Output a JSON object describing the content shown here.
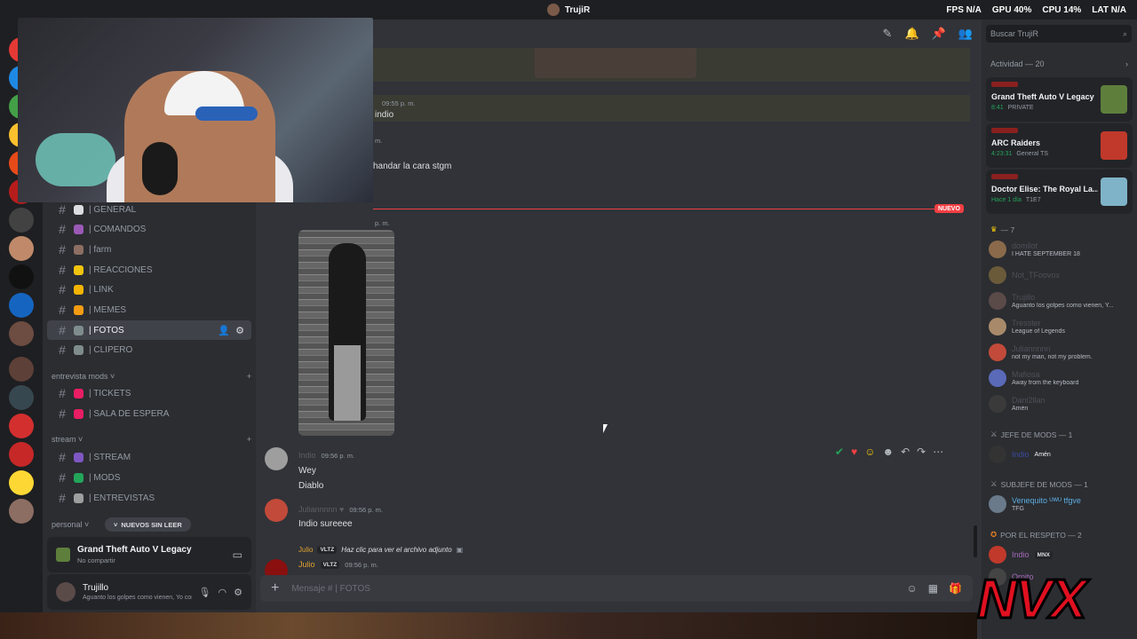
{
  "window": {
    "title": "TrujiR",
    "perf": {
      "fps_label": "FPS",
      "fps": "N/A",
      "gpu_label": "GPU",
      "gpu": "40%",
      "cpu_label": "CPU",
      "cpu": "14%",
      "lat_label": "LAT",
      "lat": "N/A"
    }
  },
  "sidebar": {
    "channels": [
      {
        "label": "| GENERAL",
        "color": "#dbdee1"
      },
      {
        "label": "| COMANDOS",
        "color": "#9b59b6"
      },
      {
        "label": "| farm",
        "color": "#8d6e63"
      },
      {
        "label": "| REACCIONES",
        "color": "#f1c40f"
      },
      {
        "label": "| LINK",
        "color": "#f4b400"
      },
      {
        "label": "| MEMES",
        "color": "#f39c12"
      },
      {
        "label": "| FOTOS",
        "color": "#7f8c8d",
        "active": true
      },
      {
        "label": "| CLIPERO",
        "color": "#7f8c8d"
      }
    ],
    "cat_mods": "entrevista mods",
    "mods_channels": [
      {
        "label": "| TICKETS",
        "color": "#e91e63"
      },
      {
        "label": "| SALA DE ESPERA",
        "color": "#e91e63"
      }
    ],
    "cat_stream": "stream",
    "stream_channels": [
      {
        "label": "| STREAM",
        "color": "#7e57c2"
      },
      {
        "label": "| MODS",
        "color": "#23a55a"
      },
      {
        "label": "| ENTREVISTAS",
        "color": "#9e9e9e"
      }
    ],
    "cat_personal": "personal",
    "new_unread": "NUEVOS SIN LEER",
    "activity": {
      "game": "Grand Theft Auto V Legacy",
      "sub": "No compartir"
    },
    "user": {
      "name": "Trujillo",
      "status": "Aguanto los golpes como vienen, Yo como ..."
    }
  },
  "chat": {
    "top_message_time": "09:55 p. m.",
    "top_message_text": "indio",
    "partial_ts": "m.",
    "msg2_text": "handar la cara stgm",
    "partial_ts2": "p. m.",
    "new_label": "NUEVO",
    "messages": [
      {
        "time": "09:56 p. m.",
        "lines": [
          "Wey",
          "Diablo"
        ]
      },
      {
        "time": "09:56 p. m.",
        "lines": [
          "Indio sureeee"
        ]
      }
    ],
    "reply": {
      "author": "Julio",
      "badge": "VLTZ",
      "text": "Haz clic para ver el archivo adjunto"
    },
    "last": {
      "author": "Julio",
      "badge": "VLTZ",
      "time": "09:56 p. m.",
      "text": "."
    },
    "composer_placeholder": "Mensaje #",
    "composer_channel": "| FOTOS"
  },
  "right": {
    "search_placeholder": "Buscar TrujiR",
    "activity_header": "Actividad — 20",
    "cards": [
      {
        "game": "Grand Theft Auto V Legacy",
        "time": "8:41",
        "extra": "PRIVATE",
        "color": "#5e7f3c"
      },
      {
        "game": "ARC Raiders",
        "time": "4:23:31",
        "extra": "General TS",
        "color": "#c0392b"
      },
      {
        "game": "Doctor Elise: The Royal La...",
        "time": "Hace 1 día",
        "extra": "T1E7",
        "color": "#7fb3c8"
      }
    ],
    "group_count": "— 7",
    "members": [
      {
        "name": "domilot",
        "status": "I HATE SEPTEMBER 18",
        "color": "#8a6a4a"
      },
      {
        "name": "Not_TFoovox",
        "status": "",
        "color": "#6a5a3a"
      },
      {
        "name": "Trujillo",
        "status": "Aguanto los golpes como vienen, Y...",
        "color": "#5a4a48"
      },
      {
        "name": "Tresster",
        "status": "League of Legends",
        "color": "#a88a6a"
      },
      {
        "name": "Juliannnnn",
        "status": "not my man, not my problem.",
        "color": "#c24a3a"
      },
      {
        "name": "Mafiosa",
        "status": "Away from the keyboard",
        "color": "#5a6ab8"
      },
      {
        "name": "Dani2llan",
        "status": "Amén",
        "color": "#3a3a3a"
      }
    ],
    "jefe_label": "JEFE DE MODS — 1",
    "jefe_member": {
      "name": "Indio",
      "status": "Amén"
    },
    "subjefe_label": "SUBJEFE DE MODS — 1",
    "subjefe_member": {
      "name": "Venequito ᵁᵂᵁ tfgve",
      "status": "TFG"
    },
    "respeto_label": "POR EL RESPETO — 2",
    "respeto_members": [
      {
        "name": "Indio",
        "status": "MNX"
      },
      {
        "name": "Ornito",
        "status": ""
      }
    ]
  },
  "overlay": {
    "logo_text": "NVX"
  },
  "colors": {
    "accent_red": "#f23f43",
    "online": "#23a55a"
  }
}
